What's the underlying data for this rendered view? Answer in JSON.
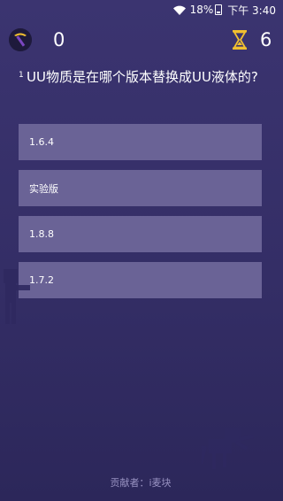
{
  "status_bar": {
    "battery_percent": "18%",
    "time": "下午 3:40"
  },
  "topbar": {
    "score": "0",
    "timer": "6",
    "score_icon": "pickaxe-icon",
    "timer_icon": "hourglass-icon"
  },
  "question": {
    "number": "1",
    "text": "UU物质是在哪个版本替换成UU液体的?"
  },
  "options": [
    {
      "label": "1.6.4"
    },
    {
      "label": "实验版"
    },
    {
      "label": "1.8.8"
    },
    {
      "label": "1.7.2"
    }
  ],
  "footer": {
    "credit": "贡献者：i麦块"
  },
  "colors": {
    "background": "#342e66",
    "option_bg": "#6a6396",
    "accent_gold": "#f2c030",
    "pick_purple": "#7a46c0"
  }
}
